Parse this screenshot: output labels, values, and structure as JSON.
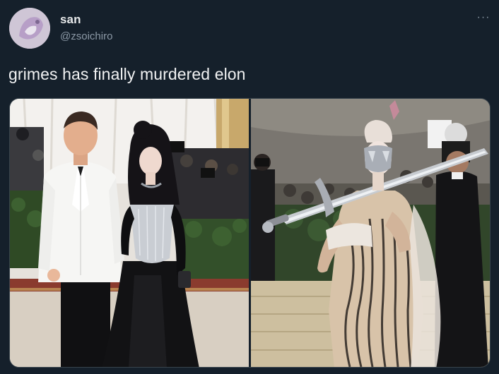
{
  "tweet": {
    "display_name": "san",
    "handle": "@zsoichiro",
    "text": "grimes has finally murdered elon",
    "more_icon": "more-horizontal-icon",
    "more_glyph": "···"
  },
  "colors": {
    "background": "#15202b",
    "text": "#e7e9ea",
    "secondary_text": "#8b98a5"
  }
}
